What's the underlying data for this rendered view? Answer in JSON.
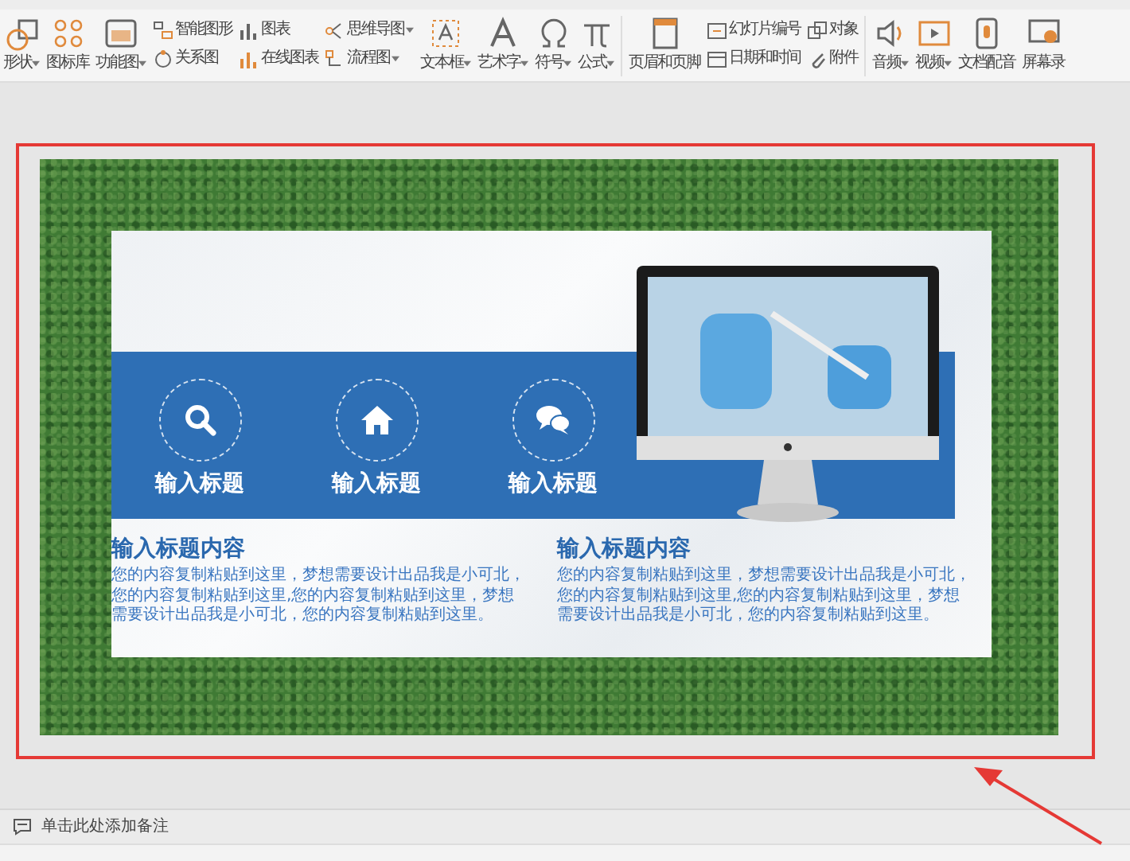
{
  "toolbar": {
    "groups": [
      {
        "kind": "large",
        "label": "形状",
        "dropdown": true
      },
      {
        "kind": "large",
        "label": "图标库",
        "dropdown": false
      },
      {
        "kind": "large",
        "label": "功能图",
        "dropdown": true
      },
      {
        "kind": "stack",
        "items": [
          {
            "label": "智能图形",
            "dropdown": false
          },
          {
            "label": "关系图",
            "dropdown": false
          }
        ]
      },
      {
        "kind": "stack",
        "items": [
          {
            "label": "图表",
            "dropdown": false
          },
          {
            "label": "在线图表",
            "dropdown": false
          }
        ]
      },
      {
        "kind": "stack",
        "items": [
          {
            "label": "思维导图",
            "dropdown": true
          },
          {
            "label": "流程图",
            "dropdown": true
          }
        ]
      },
      {
        "kind": "large",
        "label": "文本框",
        "dropdown": true
      },
      {
        "kind": "large",
        "label": "艺术字",
        "dropdown": true
      },
      {
        "kind": "large",
        "label": "符号",
        "dropdown": true
      },
      {
        "kind": "large",
        "label": "公式",
        "dropdown": true
      },
      {
        "kind": "separator"
      },
      {
        "kind": "large",
        "label": "页眉和页脚",
        "dropdown": false
      },
      {
        "kind": "stack",
        "items": [
          {
            "label": "幻灯片编号",
            "dropdown": false
          },
          {
            "label": "日期和时间",
            "dropdown": false
          }
        ]
      },
      {
        "kind": "stack",
        "items": [
          {
            "label": "对象",
            "dropdown": false
          },
          {
            "label": "附件",
            "dropdown": false
          }
        ]
      },
      {
        "kind": "separator"
      },
      {
        "kind": "large",
        "label": "音频",
        "dropdown": true
      },
      {
        "kind": "large",
        "label": "视频",
        "dropdown": true
      },
      {
        "kind": "large",
        "label": "文档配音",
        "dropdown": false
      },
      {
        "kind": "large",
        "label": "屏幕录",
        "dropdown": false
      }
    ]
  },
  "slide": {
    "features": [
      {
        "title": "输入标题"
      },
      {
        "title": "输入标题"
      },
      {
        "title": "输入标题"
      }
    ],
    "columns": [
      {
        "heading": "输入标题内容",
        "body": "您的内容复制粘贴到这里，梦想需要设计出品我是小可北，您的内容复制粘贴到这里,您的内容复制粘贴到这里，梦想需要设计出品我是小可北，您的内容复制粘贴到这里。"
      },
      {
        "heading": "输入标题内容",
        "body": "您的内容复制粘贴到这里，梦想需要设计出品我是小可北，您的内容复制粘贴到这里,您的内容复制粘贴到这里，梦想需要设计出品我是小可北，您的内容复制粘贴到这里。"
      }
    ]
  },
  "notes": {
    "placeholder": "单击此处添加备注"
  }
}
